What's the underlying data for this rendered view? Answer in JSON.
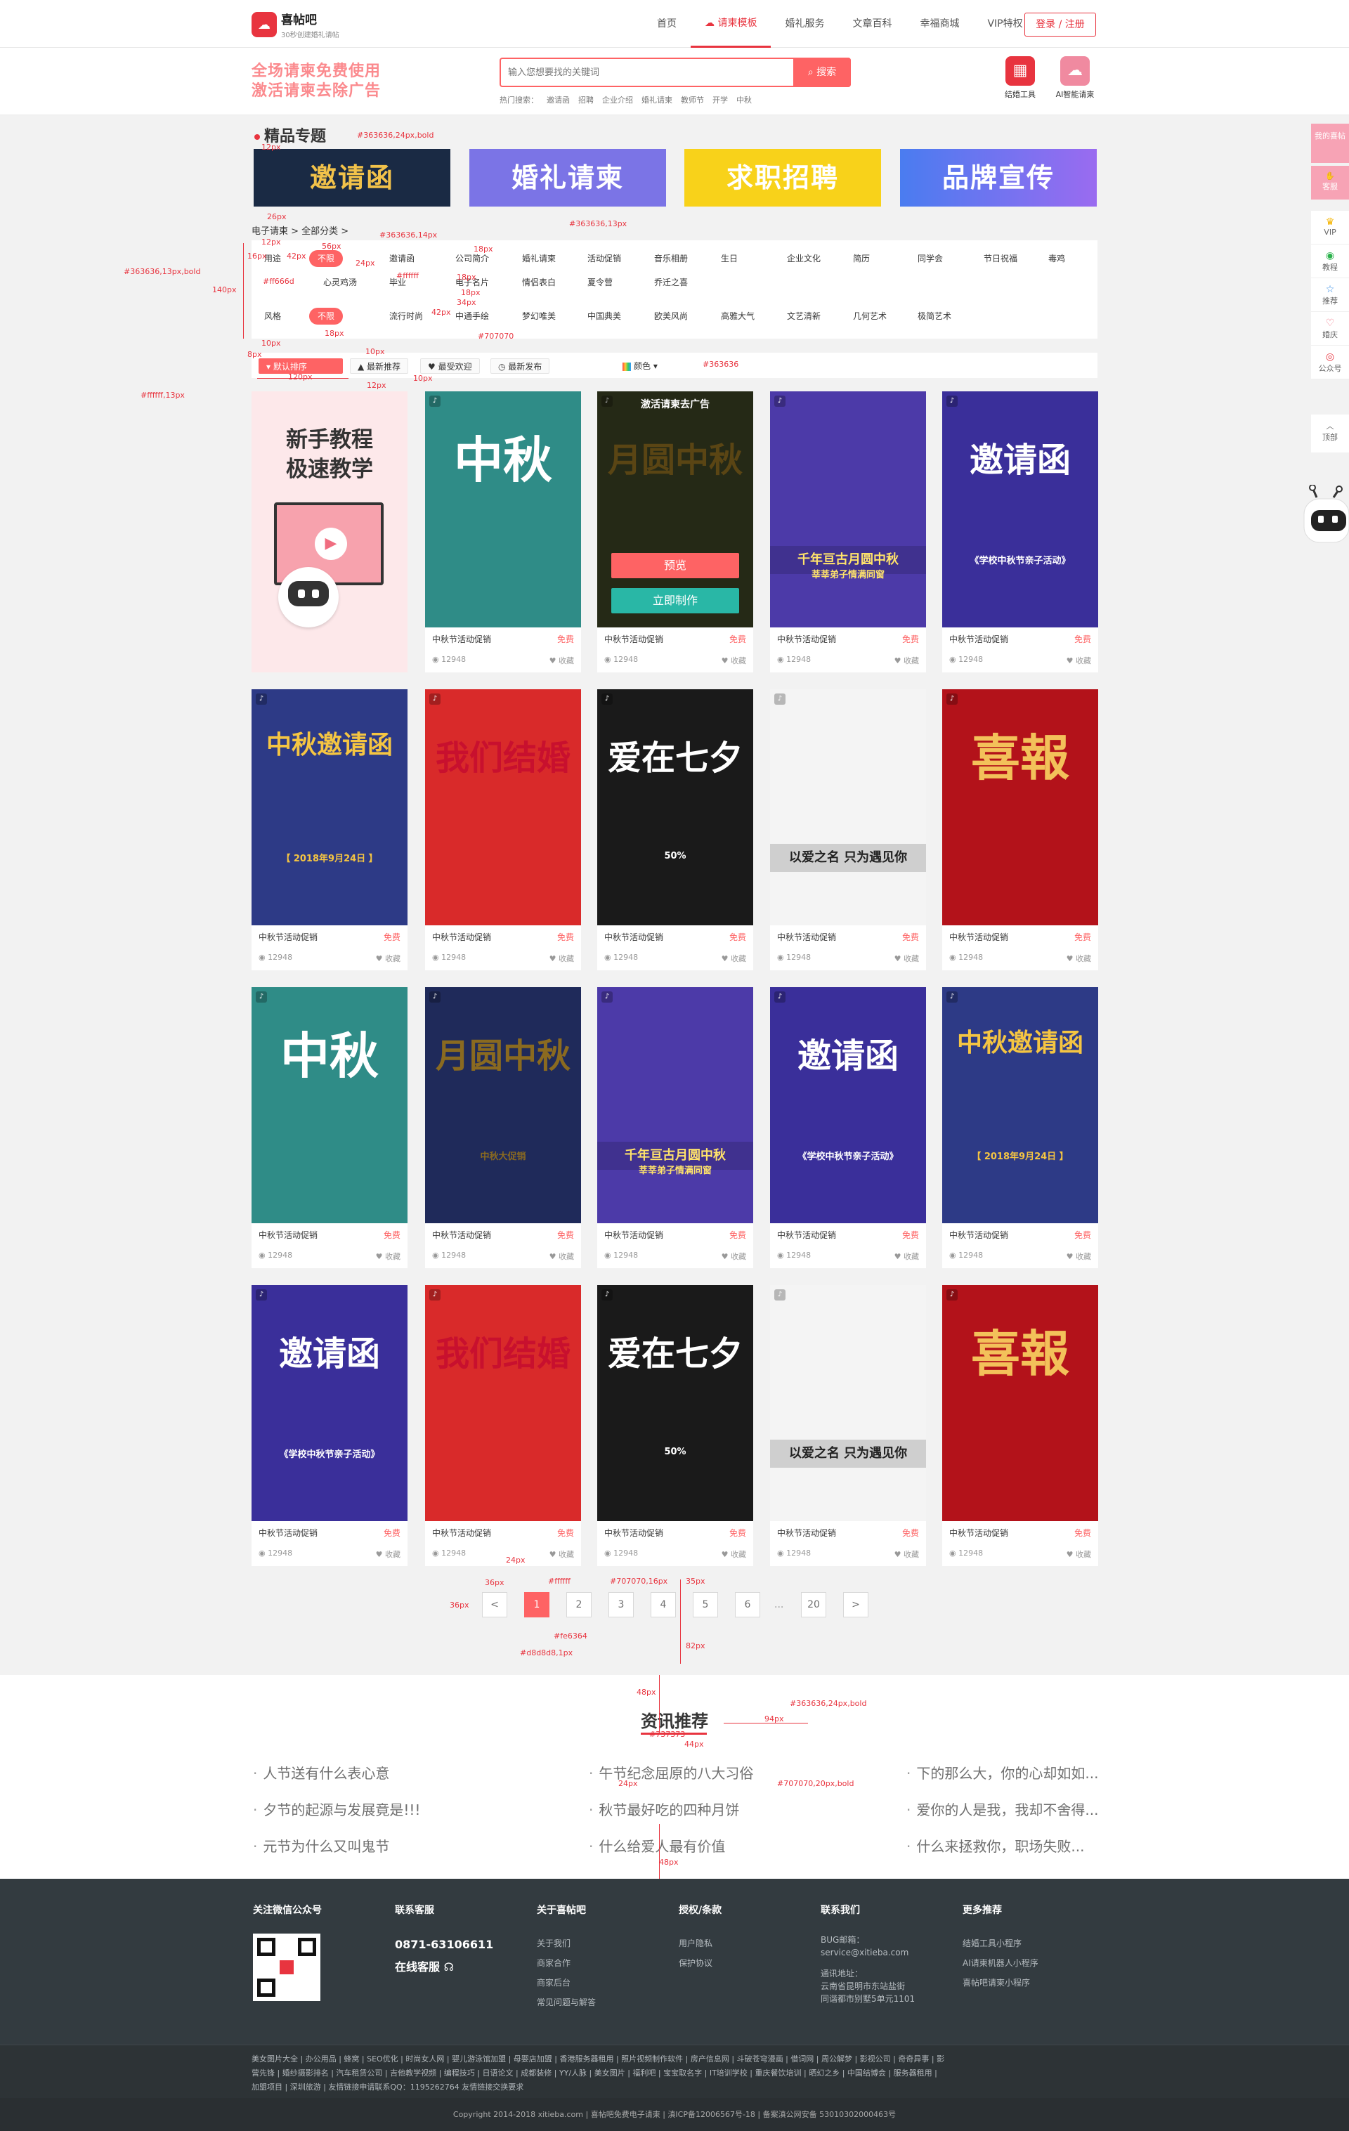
{
  "header": {
    "logo_name": "喜帖吧",
    "logo_slogan": "30秒创建婚礼请帖",
    "nav": [
      "首页",
      "请柬模板",
      "婚礼服务",
      "文章百科",
      "幸福商城",
      "VIP特权"
    ],
    "login": "登录 / 注册"
  },
  "search": {
    "promo_line1": "全场请柬免费使用",
    "promo_line2": "激活请柬去除广告",
    "placeholder": "输入您想要找的关键词",
    "button": "搜索",
    "hot_label": "热门搜索：",
    "hot_words": [
      "邀请函",
      "招聘",
      "企业介绍",
      "婚礼请柬",
      "教师节",
      "开学",
      "中秋"
    ],
    "tool1": "结婚工具",
    "tool2": "AI智能请柬"
  },
  "featured": {
    "title": "精品专题",
    "banners": [
      {
        "text": "邀请函",
        "color": "#1a2a44"
      },
      {
        "text": "婚礼请柬",
        "color": "#7b74e6"
      },
      {
        "text": "求职招聘",
        "color": "#f8d21a"
      },
      {
        "text": "品牌宣传",
        "color": "#4a7cf0"
      }
    ]
  },
  "breadcrumb": "电子请柬 > 全部分类 >",
  "filters": {
    "use_label": "用途",
    "style_label": "风格",
    "all_label": "不限",
    "use_options_row1": [
      "邀请函",
      "公司简介",
      "婚礼请柬",
      "活动促销",
      "音乐相册",
      "生日",
      "企业文化",
      "简历",
      "同学会",
      "节日祝福",
      "毒鸡"
    ],
    "use_options_row2": [
      "心灵鸡汤",
      "毕业",
      "电子名片",
      "情侣表白",
      "夏令营",
      "乔迁之喜"
    ],
    "style_options": [
      "流行时尚",
      "中通手绘",
      "梦幻唯美",
      "中国典美",
      "欧美风尚",
      "高雅大气",
      "文艺清新",
      "几何艺术",
      "极简艺术"
    ]
  },
  "sort": {
    "options": [
      "默认排序",
      "最新推荐",
      "最受欢迎",
      "最新发布"
    ],
    "color_label": "颜色"
  },
  "tutorial": {
    "line1": "新手教程",
    "line2": "极速教学"
  },
  "hover": {
    "top": "激活请柬去广告",
    "preview": "预览",
    "make": "立即制作"
  },
  "cards": [
    {
      "title": "中秋节活动促销",
      "free": "免费",
      "views": "12948",
      "fav": "收藏",
      "poster_text": "中秋",
      "poster_sub": "",
      "bg": "#2f8c87",
      "fg": "#ffffff"
    },
    {
      "title": "中秋节活动促销",
      "free": "免费",
      "views": "12948",
      "fav": "收藏",
      "poster_text": "月圆中秋",
      "poster_sub": "",
      "bg": "#3a3f23",
      "fg": "#8a6a20"
    },
    {
      "title": "中秋节活动促销",
      "free": "免费",
      "views": "12948",
      "fav": "收藏",
      "poster_text": "千年亘古月圆中秋",
      "poster_sub": "莘莘弟子情满同窗",
      "bg": "#4c3aa8",
      "fg": "#ffe36b"
    },
    {
      "title": "中秋节活动促销",
      "free": "免费",
      "views": "12948",
      "fav": "收藏",
      "poster_text": "邀请函",
      "poster_sub": "《学校中秋节亲子活动》",
      "bg": "#3a2f9a",
      "fg": "#ffffff"
    },
    {
      "title": "中秋节活动促销",
      "free": "免费",
      "views": "12948",
      "fav": "收藏",
      "poster_text": "中秋邀请函",
      "poster_sub": "【 2018年9月24日 】",
      "bg": "#2d3a86",
      "fg": "#f5c542"
    },
    {
      "title": "中秋节活动促销",
      "free": "免费",
      "views": "12948",
      "fav": "收藏",
      "poster_text": "我们结婚",
      "poster_sub": "",
      "bg": "#d92a2a",
      "fg": "#c8102e"
    },
    {
      "title": "中秋节活动促销",
      "free": "免费",
      "views": "12948",
      "fav": "收藏",
      "poster_text": "爱在七夕",
      "poster_sub": "50%",
      "bg": "#1a1a1a",
      "fg": "#ffffff"
    },
    {
      "title": "中秋节活动促销",
      "free": "免费",
      "views": "12948",
      "fav": "收藏",
      "poster_text": "以爱之名 只为遇见你",
      "poster_sub": "",
      "bg": "#f4f4f4",
      "fg": "#222222"
    },
    {
      "title": "中秋节活动促销",
      "free": "免费",
      "views": "12948",
      "fav": "收藏",
      "poster_text": "喜報",
      "poster_sub": "",
      "bg": "#b3121a",
      "fg": "#f3c15a"
    },
    {
      "title": "中秋节活动促销",
      "free": "免费",
      "views": "12948",
      "fav": "收藏",
      "poster_text": "中秋",
      "poster_sub": "",
      "bg": "#2f8c87",
      "fg": "#ffffff"
    },
    {
      "title": "中秋节活动促销",
      "free": "免费",
      "views": "12948",
      "fav": "收藏",
      "poster_text": "月圆中秋",
      "poster_sub": "中秋大促销",
      "bg": "#1f2a5a",
      "fg": "#8a6a20"
    },
    {
      "title": "中秋节活动促销",
      "free": "免费",
      "views": "12948",
      "fav": "收藏",
      "poster_text": "千年亘古月圆中秋",
      "poster_sub": "莘莘弟子情满同窗",
      "bg": "#4c3aa8",
      "fg": "#ffe36b"
    },
    {
      "title": "中秋节活动促销",
      "free": "免费",
      "views": "12948",
      "fav": "收藏",
      "poster_text": "邀请函",
      "poster_sub": "《学校中秋节亲子活动》",
      "bg": "#3a2f9a",
      "fg": "#ffffff"
    },
    {
      "title": "中秋节活动促销",
      "free": "免费",
      "views": "12948",
      "fav": "收藏",
      "poster_text": "中秋邀请函",
      "poster_sub": "【 2018年9月24日 】",
      "bg": "#2d3a86",
      "fg": "#f5c542"
    },
    {
      "title": "中秋节活动促销",
      "free": "免费",
      "views": "12948",
      "fav": "收藏",
      "poster_text": "邀请函",
      "poster_sub": "《学校中秋节亲子活动》",
      "bg": "#3a2f9a",
      "fg": "#ffffff"
    },
    {
      "title": "中秋节活动促销",
      "free": "免费",
      "views": "12948",
      "fav": "收藏",
      "poster_text": "我们结婚",
      "poster_sub": "",
      "bg": "#d92a2a",
      "fg": "#c8102e"
    },
    {
      "title": "中秋节活动促销",
      "free": "免费",
      "views": "12948",
      "fav": "收藏",
      "poster_text": "爱在七夕",
      "poster_sub": "50%",
      "bg": "#1a1a1a",
      "fg": "#ffffff"
    },
    {
      "title": "中秋节活动促销",
      "free": "免费",
      "views": "12948",
      "fav": "收藏",
      "poster_text": "以爱之名 只为遇见你",
      "poster_sub": "",
      "bg": "#f4f4f4",
      "fg": "#222222"
    },
    {
      "title": "中秋节活动促销",
      "free": "免费",
      "views": "12948",
      "fav": "收藏",
      "poster_text": "喜報",
      "poster_sub": "",
      "bg": "#b3121a",
      "fg": "#f3c15a"
    }
  ],
  "pagination": {
    "prev": "<",
    "pages": [
      "1",
      "2",
      "3",
      "4",
      "5",
      "6"
    ],
    "dots": "...",
    "last": "20",
    "next": ">",
    "current": "1"
  },
  "news": {
    "title": "资讯推荐",
    "col1": [
      "人节送有什么表心意",
      "夕节的起源与发展竟是!!!",
      "元节为什么又叫鬼节"
    ],
    "col2": [
      "午节纪念屈原的八大习俗",
      "秋节最好吃的四种月饼",
      "什么给爱人最有价值"
    ],
    "col3": [
      "下的那么大，你的心却如如...",
      "爱你的人是我，我却不舍得...",
      "什么来拯救你，职场失败..."
    ]
  },
  "footer": {
    "wechat_head": "关注微信公众号",
    "service_head": "联系客服",
    "phone": "0871-63106611",
    "online": "在线客服",
    "about_head": "关于喜帖吧",
    "about": [
      "关于我们",
      "商家合作",
      "商家后台",
      "常见问题与解答"
    ],
    "terms_head": "授权/条款",
    "terms": [
      "用户隐私",
      "保护协议"
    ],
    "contact_head": "联系我们",
    "contact": [
      "BUG邮箱：",
      "service@xitieba.com",
      "",
      "通讯地址：",
      "云南省昆明市东站盐街",
      "同谐都市别墅5单元1101"
    ],
    "more_head": "更多推荐",
    "more": [
      "结婚工具小程序",
      "AI请柬机器人小程序",
      "喜帖吧请柬小程序"
    ],
    "links_row1": "美女图片大全 | 办公用品 | 蜂窝 | SEO优化 | 时尚女人网 | 婴儿游泳馆加盟 | 母婴店加盟 | 香港服务器租用 | 照片视频制作软件 | 房产信息网 | 斗破苍穹漫画 | 借词网 | 周公解梦 | 影视公司 | 奇奇异事 | 影",
    "links_row2": "营先锋 | 婚纱摄影排名 | 汽车租赁公司 | 吉他教学视频 | 编程技巧 | 日语论文 | 成都装修 | YY/人脉 | 美女图片 | 福利吧 | 宝宝取名字 | IT培训学校 | 重庆餐饮培训 | 晒幻之乡 | 中国结博会 | 服务器租用 |",
    "links_row3": "加盟项目 | 深圳旅游 | 友情链接申请联系QQ：1195262764 友情链接交换要求",
    "copyright": "Copyright 2014-2018 xitieba.com | 喜帖吧免费电子请柬 | 滇ICP备12006567号-18 | 备案滇公网安备 53010302000463号"
  },
  "sidebar": {
    "my": "我的喜帖",
    "service": "客服",
    "items": [
      "VIP",
      "教程",
      "推荐",
      "婚庆",
      "公众号"
    ],
    "top": "顶部"
  },
  "annotations": [
    "#363636,24px,bold",
    "12px",
    "26px",
    "#363636,14px",
    "#363636,13px",
    "56px",
    "18px",
    "12px",
    "16px",
    "42px",
    "24px",
    "18px",
    "#363636,13px,bold",
    "#ff666d",
    "#ffffff",
    "140px",
    "18px",
    "42px",
    "34px",
    "18px",
    "#707070",
    "10px",
    "10px",
    "8px",
    "120px",
    "#363636",
    "10px",
    "12px",
    "#ffffff,13px",
    "24px",
    "36px",
    "#ffffff",
    "#707070,16px",
    "35px",
    "36px",
    "#fe6364",
    "#d8d8d8,1px",
    "82px",
    "48px",
    "#363636,24px,bold",
    "44px",
    "94px",
    "#737373",
    "24px",
    "#707070,20px,bold",
    "48px"
  ]
}
